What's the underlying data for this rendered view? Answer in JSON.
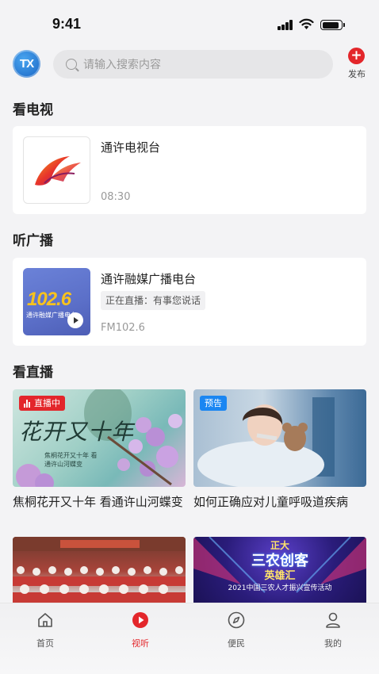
{
  "status": {
    "time": "9:41"
  },
  "header": {
    "avatar_text": "TX",
    "search_placeholder": "请输入搜索内容",
    "publish_label": "发布"
  },
  "sections": {
    "tv": "看电视",
    "radio": "听广播",
    "live": "看直播"
  },
  "tv_channel": {
    "name": "通许电视台",
    "time": "08:30"
  },
  "radio_station": {
    "name": "通许融媒广播电台",
    "now_playing": "正在直播：有事您说话",
    "frequency": "FM102.6",
    "logo_text": "102.6",
    "logo_sub": "通许融媒广播电台"
  },
  "live_items": [
    {
      "title": "焦桐花开又十年 看通许山河蝶变",
      "badge": "直播中",
      "image_text": "花开又十年",
      "image_caption": "焦桐花开又十年 看通许山河蝶变"
    },
    {
      "title": "如何正确应对儿童呼吸道疾病",
      "badge": "预告"
    },
    {
      "title": ""
    },
    {
      "title": "",
      "image_text_top": "正大",
      "image_text_main": "三农创客",
      "image_text_main2": "英雄汇",
      "image_caption": "2021中国三农人才振兴宣传活动"
    }
  ],
  "tabs": [
    {
      "label": "首页",
      "icon": "home-icon"
    },
    {
      "label": "视听",
      "icon": "play-icon"
    },
    {
      "label": "便民",
      "icon": "compass-icon"
    },
    {
      "label": "我的",
      "icon": "person-icon"
    }
  ],
  "colors": {
    "accent": "#e3262b",
    "preview": "#1a86f2",
    "background": "#f3f3f5"
  }
}
